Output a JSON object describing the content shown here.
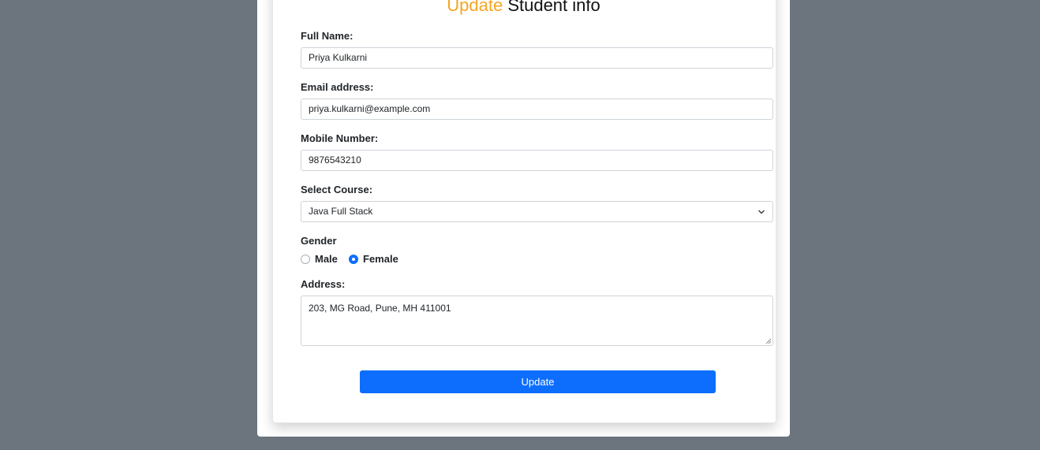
{
  "title": {
    "accent": "Update",
    "rest": "Student info"
  },
  "form": {
    "full_name": {
      "label": "Full Name:",
      "value": "Priya Kulkarni"
    },
    "email": {
      "label": "Email address:",
      "value": "priya.kulkarni@example.com"
    },
    "mobile": {
      "label": "Mobile Number:",
      "value": "9876543210"
    },
    "course": {
      "label": "Select Course:",
      "value": "Java Full Stack"
    },
    "gender": {
      "label": "Gender",
      "options": [
        "Male",
        "Female"
      ],
      "selected": "Female"
    },
    "address": {
      "label": "Address:",
      "value": "203, MG Road, Pune, MH 411001"
    },
    "submit_label": "Update"
  },
  "colors": {
    "accent": "#f5a623",
    "primary": "#0d6efd",
    "backdrop": "#6c757d"
  },
  "icons": {
    "select": "chevron-down-icon",
    "textarea": "resize-grip-icon"
  }
}
